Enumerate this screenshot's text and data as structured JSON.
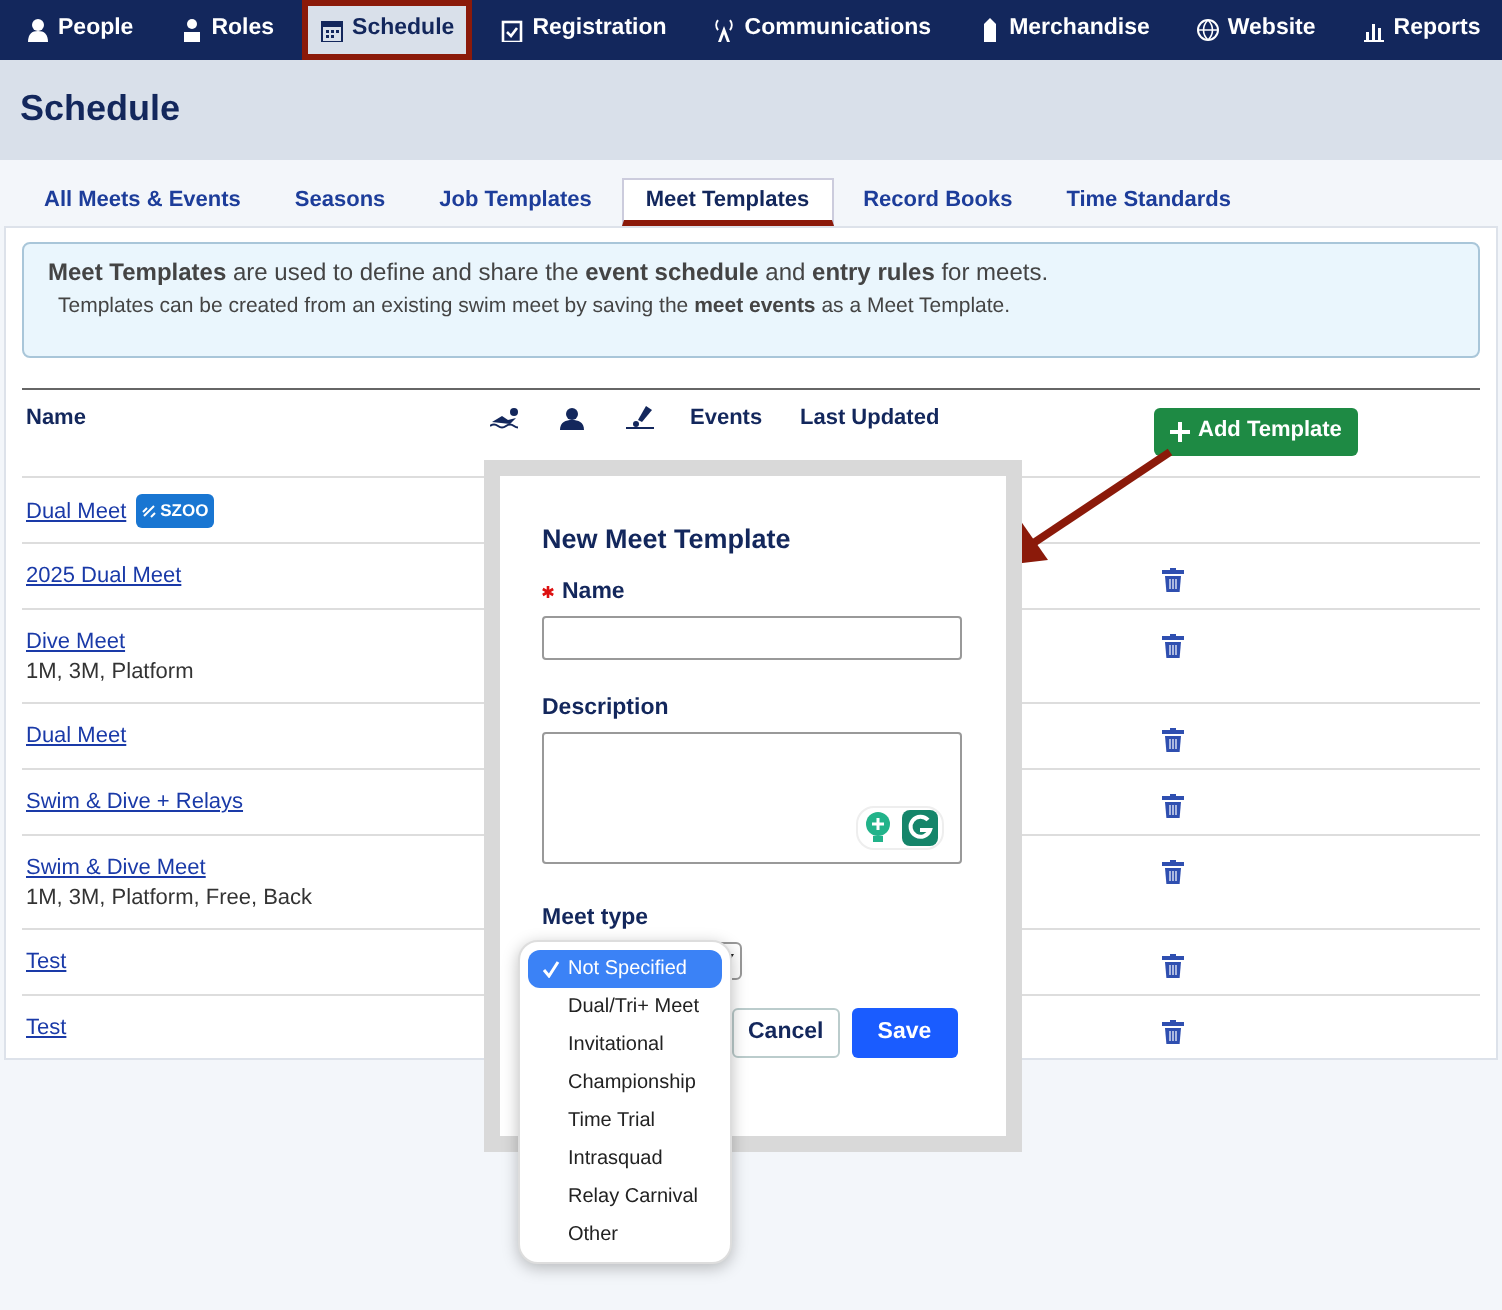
{
  "nav": [
    {
      "label": "People",
      "selected": false,
      "annotated": false
    },
    {
      "label": "Roles",
      "selected": false,
      "annotated": false
    },
    {
      "label": "Schedule",
      "selected": true,
      "annotated": true
    },
    {
      "label": "Registration",
      "selected": false,
      "annotated": false
    },
    {
      "label": "Communications",
      "selected": false,
      "annotated": false
    },
    {
      "label": "Merchandise",
      "selected": false,
      "annotated": false
    },
    {
      "label": "Website",
      "selected": false,
      "annotated": false
    },
    {
      "label": "Reports",
      "selected": false,
      "annotated": false
    }
  ],
  "page_title": "Schedule",
  "tabs": [
    {
      "label": "All Meets & Events",
      "selected": false,
      "annotated": false
    },
    {
      "label": "Seasons",
      "selected": false,
      "annotated": false
    },
    {
      "label": "Job Templates",
      "selected": false,
      "annotated": false
    },
    {
      "label": "Meet Templates",
      "selected": true,
      "annotated": true
    },
    {
      "label": "Record Books",
      "selected": false,
      "annotated": false
    },
    {
      "label": "Time Standards",
      "selected": false,
      "annotated": false
    }
  ],
  "info": {
    "text": "**Meet Templates** are used to define and share the **event schedule** and **entry rules** for meets.",
    "note": "Templates can be created from an existing swim meet by saving the **meet events** as a Meet Template."
  },
  "table": {
    "columns": [
      "Name",
      "Events",
      "Last Updated"
    ],
    "add_button": "Add Template",
    "rows": [
      {
        "name": "Dual Meet",
        "badge": "SZOO",
        "deletable": false
      },
      {
        "name": "2025 Dual Meet",
        "deletable": true
      },
      {
        "name": "Dive Meet",
        "detail": "1M, 3M, Platform",
        "deletable": true
      },
      {
        "name": "Dual Meet",
        "deletable": true
      },
      {
        "name": "Swim & Dive + Relays",
        "deletable": true
      },
      {
        "name": "Swim & Dive Meet",
        "detail": "1M, 3M, Platform, Free, Back",
        "deletable": true
      },
      {
        "name": "Test",
        "deletable": true
      },
      {
        "name": "Test",
        "deletable": true
      }
    ]
  },
  "annotation_arrow": true,
  "modal": {
    "title": "New Meet Template",
    "name_label": "Name",
    "name_required": true,
    "description_label": "Description",
    "meet_type_label": "Meet type",
    "options": [
      {
        "label": "Not Specified",
        "selected": true
      },
      {
        "label": "Dual/Tri+ Meet",
        "selected": false
      },
      {
        "label": "Invitational",
        "selected": false
      },
      {
        "label": "Championship",
        "selected": false
      },
      {
        "label": "Time Trial",
        "selected": false
      },
      {
        "label": "Intrasquad",
        "selected": false
      },
      {
        "label": "Relay Carnival",
        "selected": false
      },
      {
        "label": "Other",
        "selected": false
      }
    ],
    "cancel": "Cancel",
    "save": "Save"
  }
}
